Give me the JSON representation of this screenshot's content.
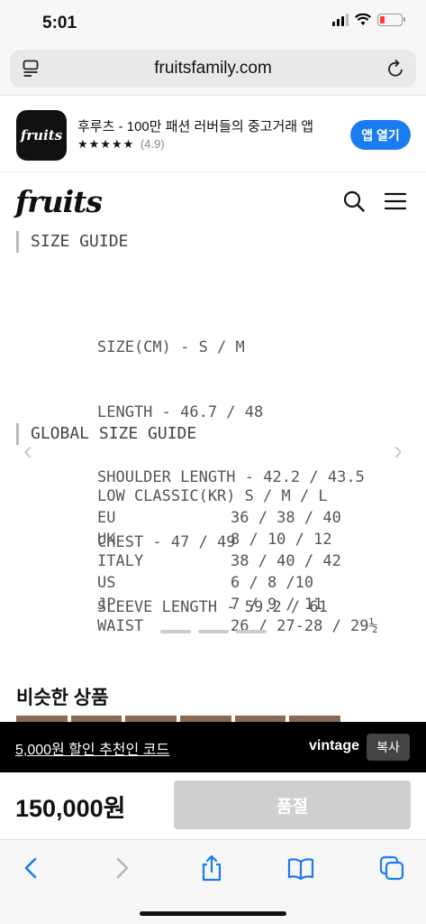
{
  "status_bar": {
    "time": "5:01"
  },
  "browser": {
    "url": "fruitsfamily.com"
  },
  "app_banner": {
    "icon_text": "fruits",
    "title": "후루츠 - 100만 패션 러버들의 중고거래 앱",
    "stars": "★★★★★",
    "rating": "(4.9)",
    "open_label": "앱 열기"
  },
  "site_header": {
    "logo": "fruits"
  },
  "description": {
    "size_guide_heading": "SIZE GUIDE",
    "size_lines": [
      "SIZE(CM) - S / M",
      "LENGTH - 46.7 / 48",
      "SHOULDER LENGTH - 42.2 / 43.5",
      "CHEST - 47 / 49",
      "SLEEVE LENGTH - 59.2 / 61"
    ],
    "global_heading": "GLOBAL SIZE GUIDE",
    "global_header": {
      "label": "LOW CLASSIC(KR)",
      "value": "S / M / L"
    },
    "global_rows": [
      {
        "label": "EU",
        "value": "36 / 38 / 40"
      },
      {
        "label": "UK",
        "value": "8 / 10 / 12"
      },
      {
        "label": "ITALY",
        "value": "38 / 40 / 42"
      },
      {
        "label": "US",
        "value": "6 / 8 /10"
      },
      {
        "label": "JP",
        "value": "7 / 9 / 11"
      },
      {
        "label": "WAIST",
        "value": "26 / 27-28 / 29½"
      }
    ]
  },
  "similar": {
    "title": "비슷한 상품"
  },
  "referral": {
    "text": "5,000원 할인 추천인 코드",
    "code": "vintage",
    "copy_label": "복사"
  },
  "purchase": {
    "price": "150,000원",
    "status_label": "품절"
  },
  "colors": {
    "accent": "#1a7cf0",
    "battery_low": "#ff3b30",
    "soldout": "#cfcfcf"
  }
}
